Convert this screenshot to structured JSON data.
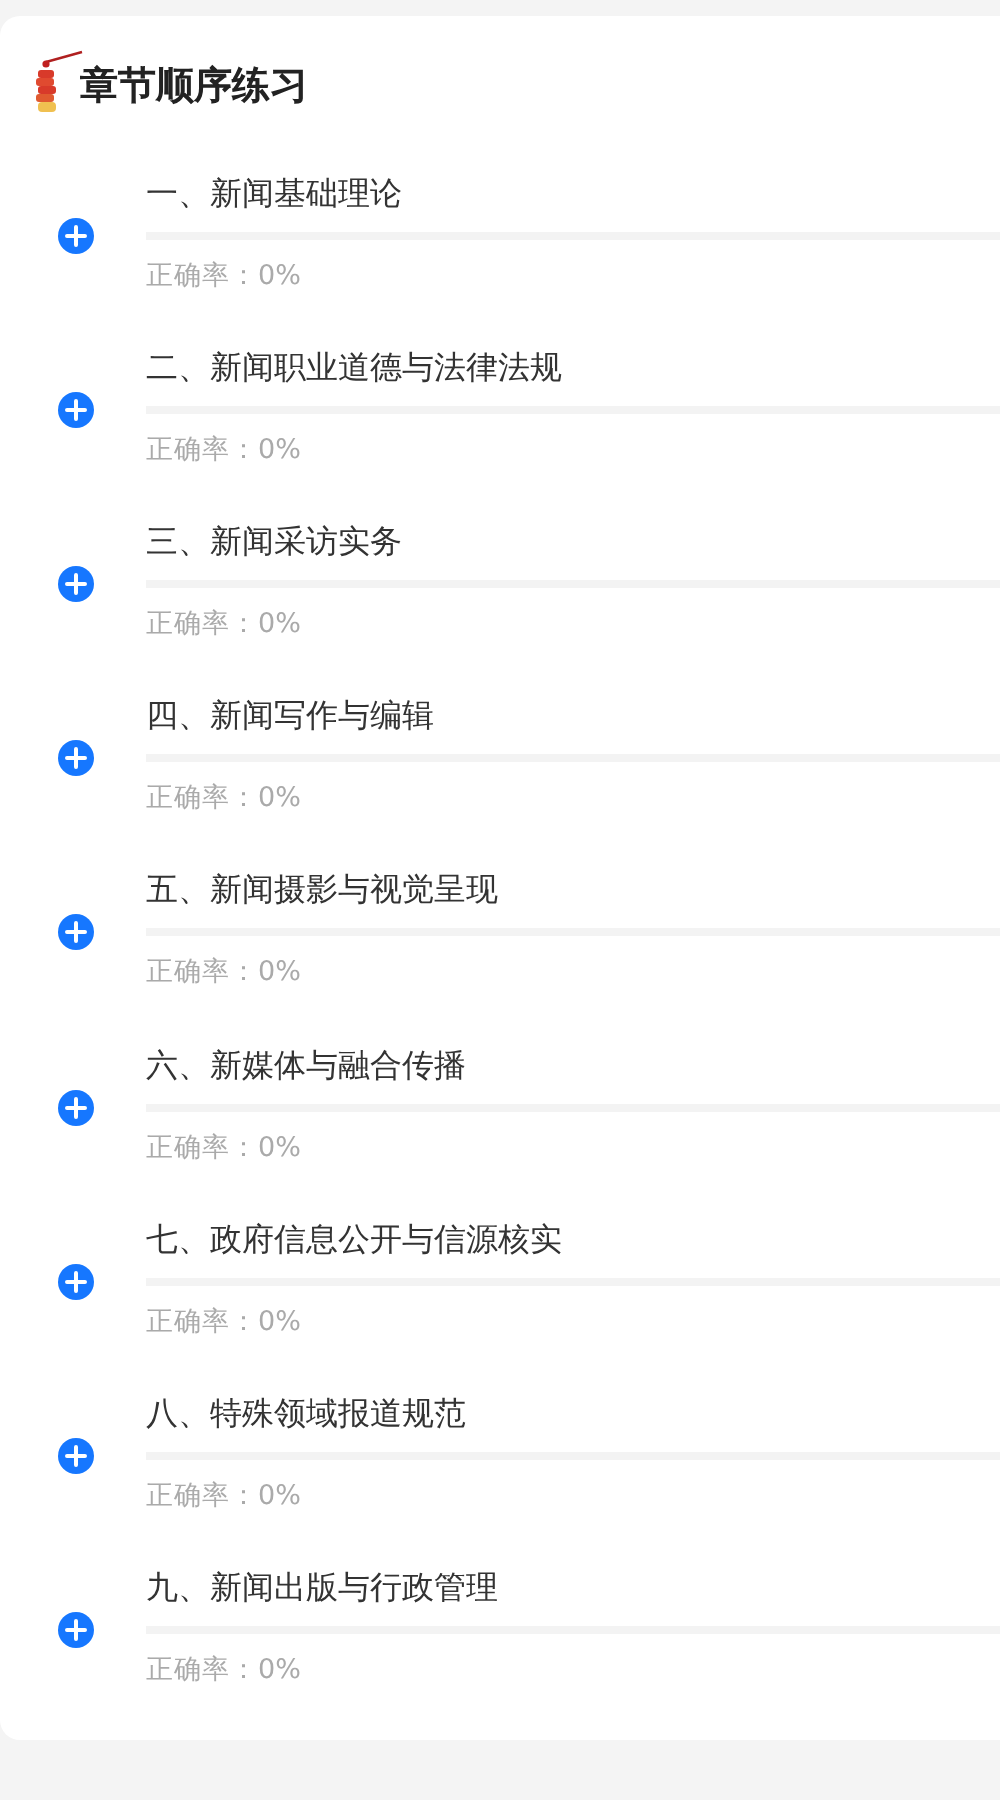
{
  "section": {
    "title": "章节顺序练习"
  },
  "chapters": [
    {
      "title": "一、新闻基础理论",
      "accuracy": "正确率：0%",
      "level": 0
    },
    {
      "title": "二、新闻职业道德与法律法规",
      "accuracy": "正确率：0%",
      "level": 0
    },
    {
      "title": "三、新闻采访实务",
      "accuracy": "正确率：0%",
      "level": 0
    },
    {
      "title": "四、新闻写作与编辑",
      "accuracy": "正确率：0%",
      "level": 0
    },
    {
      "title": "五、新闻摄影与视觉呈现",
      "accuracy": "正确率：0%",
      "level": 0
    },
    {
      "title": "六、新媒体与融合传播",
      "accuracy": "正确率：0%",
      "level": 0
    },
    {
      "title": "七、政府信息公开与信源核实",
      "accuracy": "正确率：0%",
      "level": 0
    },
    {
      "title": "八、特殊领域报道规范",
      "accuracy": "正确率：0%",
      "level": 0
    },
    {
      "title": "九、新闻出版与行政管理",
      "accuracy": "正确率：0%",
      "level": 0
    }
  ]
}
